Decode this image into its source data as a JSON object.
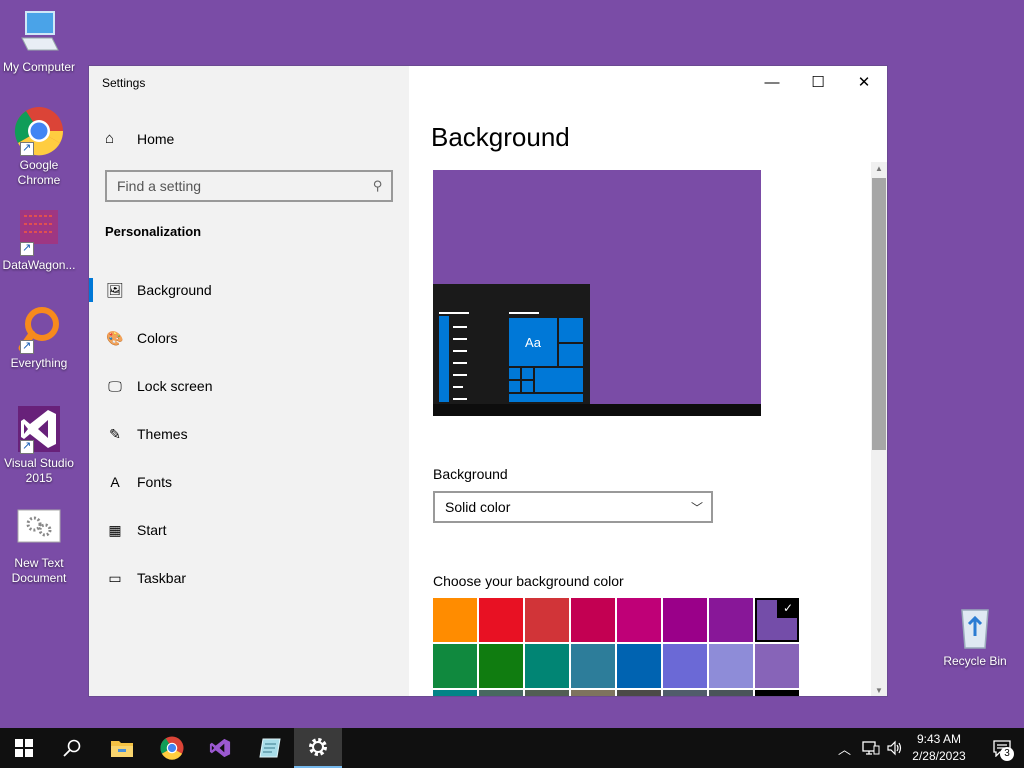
{
  "desktop": {
    "icons": [
      {
        "label": "My Computer",
        "icon": "computer-icon"
      },
      {
        "label": "Google Chrome",
        "icon": "chrome-icon"
      },
      {
        "label": "DataWagon...",
        "icon": "datawagon-icon"
      },
      {
        "label": "Everything",
        "icon": "everything-search-icon"
      },
      {
        "label": "Visual Studio 2015",
        "icon": "visual-studio-icon"
      },
      {
        "label": "New Text Document",
        "icon": "text-document-icon"
      },
      {
        "label": "Recycle Bin",
        "icon": "recycle-bin-icon"
      }
    ]
  },
  "window": {
    "title": "Settings",
    "controls": {
      "minimize": "—",
      "maximize": "☐",
      "close": "✕"
    }
  },
  "nav": {
    "home_label": "Home",
    "search_placeholder": "Find a setting",
    "section_title": "Personalization",
    "items": [
      {
        "label": "Background",
        "icon": "picture-icon",
        "glyph": "🖼",
        "active": true
      },
      {
        "label": "Colors",
        "icon": "palette-icon",
        "glyph": "🎨",
        "active": false
      },
      {
        "label": "Lock screen",
        "icon": "lock-screen-icon",
        "glyph": "🖵",
        "active": false
      },
      {
        "label": "Themes",
        "icon": "themes-icon",
        "glyph": "✎",
        "active": false
      },
      {
        "label": "Fonts",
        "icon": "fonts-icon",
        "glyph": "A",
        "active": false
      },
      {
        "label": "Start",
        "icon": "start-icon",
        "glyph": "▦",
        "active": false
      },
      {
        "label": "Taskbar",
        "icon": "taskbar-icon",
        "glyph": "▭",
        "active": false
      }
    ]
  },
  "content": {
    "page_title": "Background",
    "preview_tile_text": "Aa",
    "background_label": "Background",
    "background_value": "Solid color",
    "color_label": "Choose your background color",
    "selected_color": "#744da9",
    "swatch_colors": [
      "#ff8c00",
      "#e81123",
      "#d13438",
      "#c30052",
      "#bf0077",
      "#9a0089",
      "#881798",
      "#744da9",
      "#10893e",
      "#107c10",
      "#018574",
      "#2d7d9a",
      "#0063b1",
      "#6b69d6",
      "#8e8cd8",
      "#8764b8",
      "#038387",
      "#486860",
      "#525e54",
      "#7e735f",
      "#4c4a48",
      "#515c6b",
      "#4a5459",
      "#000000"
    ]
  },
  "taskbar": {
    "apps": [
      {
        "icon": "start-windows-icon"
      },
      {
        "icon": "search-icon"
      },
      {
        "icon": "file-explorer-icon"
      },
      {
        "icon": "chrome-icon"
      },
      {
        "icon": "visual-studio-icon"
      },
      {
        "icon": "notepad-icon"
      },
      {
        "icon": "settings-gear-icon",
        "active": true
      }
    ],
    "time": "9:43 AM",
    "date": "2/28/2023",
    "notification_count": "3"
  }
}
